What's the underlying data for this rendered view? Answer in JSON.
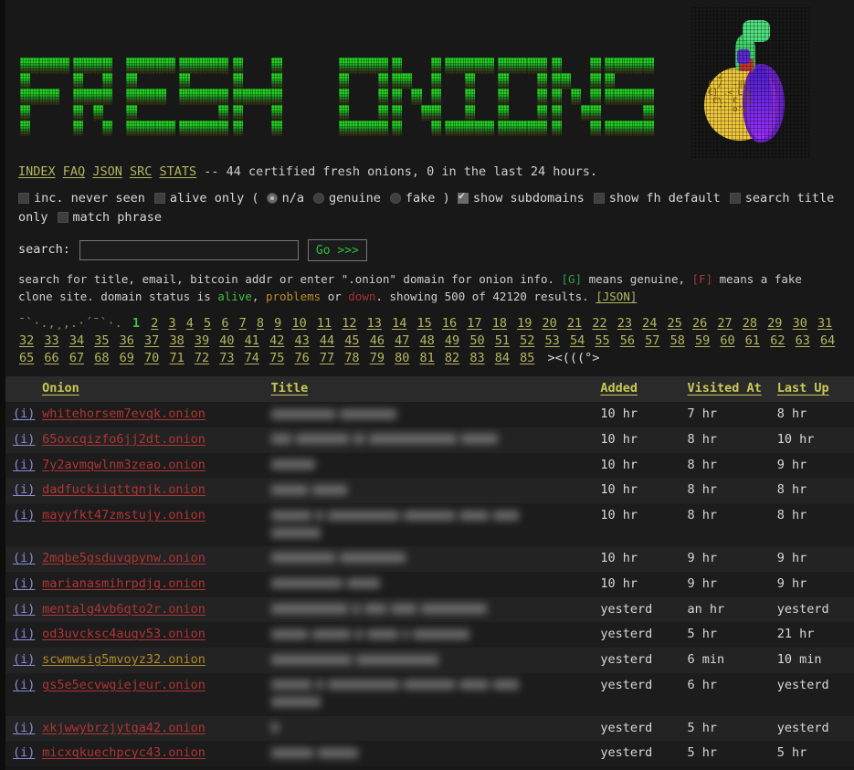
{
  "site": {
    "logo_text": "FRESH ONIONS",
    "logo_icon": "onion-ascii-art"
  },
  "nav": {
    "links": [
      {
        "label": "INDEX",
        "name": "nav-index"
      },
      {
        "label": "FAQ",
        "name": "nav-faq"
      },
      {
        "label": "JSON",
        "name": "nav-json"
      },
      {
        "label": "SRC",
        "name": "nav-src"
      },
      {
        "label": "STATS",
        "name": "nav-stats"
      }
    ],
    "status_text": "-- 44 certified fresh onions, 0 in the last 24 hours."
  },
  "options": {
    "inc_never_seen": {
      "label": "inc. never seen",
      "checked": false
    },
    "alive_only": {
      "label": "alive only",
      "checked": false
    },
    "open_paren": "(",
    "close_paren": ")",
    "radios": [
      {
        "label": "n/a",
        "selected": true
      },
      {
        "label": "genuine",
        "selected": false
      },
      {
        "label": "fake",
        "selected": false
      }
    ],
    "show_subdomains": {
      "label": "show subdomains",
      "checked": true
    },
    "show_fh_default": {
      "label": "show fh default",
      "checked": false
    },
    "search_title_only": {
      "label": "search title only",
      "checked": false
    },
    "match_phrase": {
      "label": "match phrase",
      "checked": false
    }
  },
  "search": {
    "label": "search:",
    "value": "",
    "placeholder": "",
    "button_label": "Go >>>"
  },
  "help": {
    "line1_a": "search for title, email, bitcoin addr or enter \".onion\" domain for onion info. ",
    "g_tag": "[G]",
    "line1_b": " means genuine, ",
    "f_tag": "[F]",
    "line1_c": " means a fake",
    "line2_a": "clone site. domain status is ",
    "status_alive": "alive",
    "line2_b": ", ",
    "status_problems": "problems",
    "line2_c": " or ",
    "status_down": "down",
    "line2_d": ". showing 500 of 42120 results. ",
    "json_link": "[JSON]"
  },
  "pagination": {
    "decoration": "¯`·.,¸,.·´¯`·.",
    "current_page": 1,
    "pages": [
      1,
      2,
      3,
      4,
      5,
      6,
      7,
      8,
      9,
      10,
      11,
      12,
      13,
      14,
      15,
      16,
      17,
      18,
      19,
      20,
      21,
      22,
      23,
      24,
      25,
      26,
      27,
      28,
      29,
      30,
      31,
      32,
      33,
      34,
      35,
      36,
      37,
      38,
      39,
      40,
      41,
      42,
      43,
      44,
      45,
      46,
      47,
      48,
      49,
      50,
      51,
      52,
      53,
      54,
      55,
      56,
      57,
      58,
      59,
      60,
      61,
      62,
      63,
      64,
      65,
      66,
      67,
      68,
      69,
      70,
      71,
      72,
      73,
      74,
      75,
      76,
      77,
      78,
      79,
      80,
      81,
      82,
      83,
      84,
      85
    ],
    "fish": "><(((°>"
  },
  "table": {
    "columns": [
      {
        "label": "",
        "name": "col-info"
      },
      {
        "label": "Onion",
        "name": "col-onion"
      },
      {
        "label": "Title",
        "name": "col-title"
      },
      {
        "label": "Added",
        "name": "col-added"
      },
      {
        "label": "Visited At",
        "name": "col-visited-at"
      },
      {
        "label": "Last Up",
        "name": "col-last-up"
      }
    ],
    "info_label": "(i)",
    "rows": [
      {
        "onion": "whitehorsem7evqk.onion",
        "status": "down",
        "title_blurred": [
          70,
          62
        ],
        "title_blurred2": [],
        "added": "10 hr",
        "visited": "7 hr",
        "lastup": "8 hr"
      },
      {
        "onion": "65oxcqizfo6jj2dt.onion",
        "status": "down",
        "title_blurred": [
          22,
          58,
          12,
          96,
          40
        ],
        "title_blurred2": [],
        "added": "10 hr",
        "visited": "8 hr",
        "lastup": "10 hr"
      },
      {
        "onion": "7y2avmqwlnm3zeao.onion",
        "status": "down",
        "title_blurred": [
          48
        ],
        "title_blurred2": [],
        "added": "10 hr",
        "visited": "8 hr",
        "lastup": "9 hr"
      },
      {
        "onion": "dadfuckiiqttgnjk.onion",
        "status": "down",
        "title_blurred": [
          40,
          38
        ],
        "title_blurred2": [],
        "added": "10 hr",
        "visited": "8 hr",
        "lastup": "8 hr"
      },
      {
        "onion": "mayyfkt47zmstujy.onion",
        "status": "down",
        "title_blurred": [
          44,
          8,
          78,
          56,
          32,
          28
        ],
        "title_blurred2": [
          54
        ],
        "added": "10 hr",
        "visited": "8 hr",
        "lastup": "8 hr"
      },
      {
        "onion": "2mqbe5gsduvqpynw.onion",
        "status": "down",
        "title_blurred": [
          70,
          72
        ],
        "title_blurred2": [],
        "added": "10 hr",
        "visited": "9 hr",
        "lastup": "9 hr"
      },
      {
        "onion": "marianasmihrpdjg.onion",
        "status": "down",
        "title_blurred": [
          78,
          36
        ],
        "title_blurred2": [],
        "added": "10 hr",
        "visited": "9 hr",
        "lastup": "9 hr"
      },
      {
        "onion": "mentalg4vb6qto2r.onion",
        "status": "down",
        "title_blurred": [
          84,
          8,
          24,
          28,
          72
        ],
        "title_blurred2": [],
        "added": "yesterd",
        "visited": "an hr",
        "lastup": "yesterd"
      },
      {
        "onion": "od3uvcksc4augv53.onion",
        "status": "down",
        "title_blurred": [
          40,
          42,
          8,
          34,
          6,
          62
        ],
        "title_blurred2": [],
        "added": "yesterd",
        "visited": "5 hr",
        "lastup": "21 hr"
      },
      {
        "onion": "scwmwsig5mvoyz32.onion",
        "status": "problems",
        "title_blurred": [
          88,
          90
        ],
        "title_blurred2": [],
        "added": "yesterd",
        "visited": "6 min",
        "lastup": "10 min"
      },
      {
        "onion": "gs5e5ecvwgiejeur.onion",
        "status": "down",
        "title_blurred": [
          44,
          8,
          78,
          56,
          32,
          28
        ],
        "title_blurred2": [
          54
        ],
        "added": "yesterd",
        "visited": "6 hr",
        "lastup": "yesterd"
      },
      {
        "onion": "xkjwwybrzjytga42.onion",
        "status": "down",
        "title_blurred": [
          8
        ],
        "title_blurred2": [],
        "added": "yesterd",
        "visited": "5 hr",
        "lastup": "yesterd"
      },
      {
        "onion": "micxqkuechpcyc43.onion",
        "status": "down",
        "title_blurred": [
          46,
          44
        ],
        "title_blurred2": [],
        "added": "yesterd",
        "visited": "5 hr",
        "lastup": "5 hr"
      }
    ]
  },
  "colors": {
    "background": "#181818",
    "link": "#b5b560",
    "onion_down": "#b03434",
    "onion_problems": "#b08a2a",
    "onion_alive": "#3fbf3f",
    "info_link": "#8b8bd8",
    "header": "#c9c955",
    "current_page": "#3fbf3f",
    "logo_green": "#25d225",
    "onion_body": "#f0c83c",
    "onion_purple": "#7b2bd6"
  }
}
